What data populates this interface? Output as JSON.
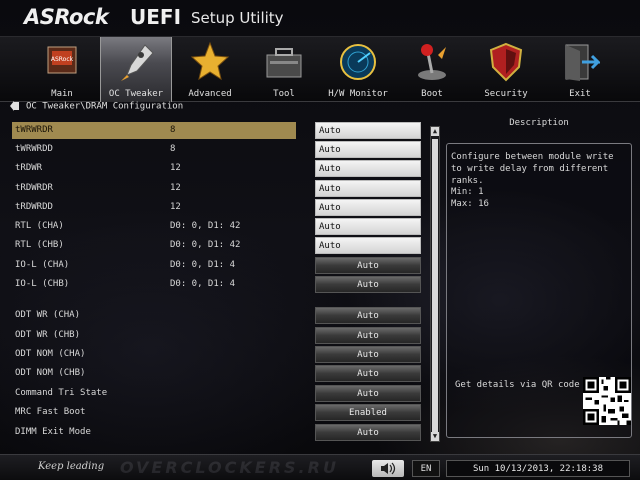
{
  "header": {
    "brand": "ASRock",
    "product": "UEFI",
    "subtitle": "Setup Utility"
  },
  "nav": {
    "items": [
      {
        "label": "Main",
        "icon": "main-icon"
      },
      {
        "label": "OC Tweaker",
        "icon": "rocket-icon",
        "active": true
      },
      {
        "label": "Advanced",
        "icon": "star-icon"
      },
      {
        "label": "Tool",
        "icon": "toolbox-icon"
      },
      {
        "label": "H/W Monitor",
        "icon": "radar-icon"
      },
      {
        "label": "Boot",
        "icon": "joystick-icon"
      },
      {
        "label": "Security",
        "icon": "shield-icon"
      },
      {
        "label": "Exit",
        "icon": "exit-door-icon"
      }
    ]
  },
  "breadcrumb": "OC Tweaker\\DRAM Configuration",
  "settings": [
    {
      "label": "tWRWRDR",
      "value": "8",
      "field": "Auto",
      "style": "light",
      "selected": true
    },
    {
      "label": "tWRWRDD",
      "value": "8",
      "field": "Auto",
      "style": "light"
    },
    {
      "label": "tRDWR",
      "value": "12",
      "field": "Auto",
      "style": "light"
    },
    {
      "label": "tRDWRDR",
      "value": "12",
      "field": "Auto",
      "style": "light"
    },
    {
      "label": "tRDWRDD",
      "value": "12",
      "field": "Auto",
      "style": "light"
    },
    {
      "label": "RTL (CHA)",
      "value": "D0: 0, D1: 42",
      "field": "Auto",
      "style": "light"
    },
    {
      "label": "RTL (CHB)",
      "value": "D0: 0, D1: 42",
      "field": "Auto",
      "style": "light"
    },
    {
      "label": "IO-L (CHA)",
      "value": "D0: 0, D1: 4",
      "field": "Auto",
      "style": "dark"
    },
    {
      "label": "IO-L (CHB)",
      "value": "D0: 0, D1: 4",
      "field": "Auto",
      "style": "dark"
    },
    {
      "label": "ODT WR (CHA)",
      "value": "",
      "field": "Auto",
      "style": "dark"
    },
    {
      "label": "ODT WR (CHB)",
      "value": "",
      "field": "Auto",
      "style": "dark"
    },
    {
      "label": "ODT NOM (CHA)",
      "value": "",
      "field": "Auto",
      "style": "dark"
    },
    {
      "label": "ODT NOM (CHB)",
      "value": "",
      "field": "Auto",
      "style": "dark"
    },
    {
      "label": "Command Tri State",
      "value": "",
      "field": "Auto",
      "style": "dark"
    },
    {
      "label": "MRC Fast Boot",
      "value": "",
      "field": "Enabled",
      "style": "dark"
    },
    {
      "label": "DIMM Exit Mode",
      "value": "",
      "field": "Auto",
      "style": "dark"
    }
  ],
  "description": {
    "title": "Description",
    "text": "Configure between module write to write delay from different ranks.",
    "min": "Min: 1",
    "max": "Max: 16",
    "qr_label": "Get details via QR code"
  },
  "footer": {
    "tagline": "Keep leading",
    "watermark": "OVERCLOCKERS.RU",
    "language": "EN",
    "datetime": "Sun 10/13/2013, 22:18:38"
  }
}
